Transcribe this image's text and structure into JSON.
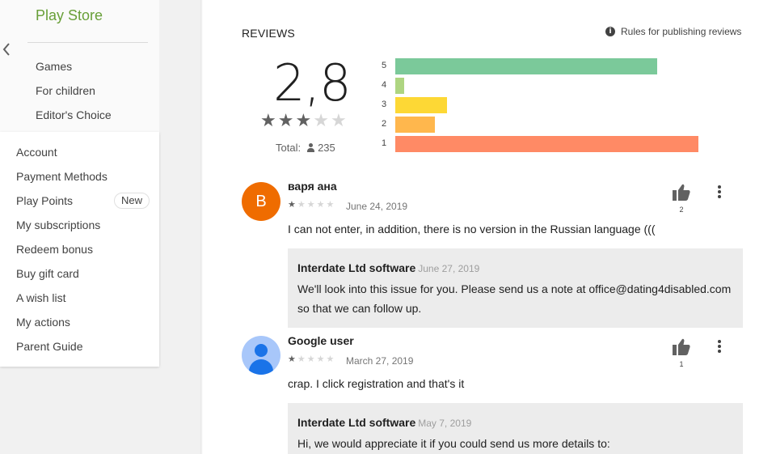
{
  "nav": {
    "store_title": "Play Store",
    "back_icon": "chevron-left-icon",
    "items": [
      {
        "label": "Games"
      },
      {
        "label": "For children"
      },
      {
        "label": "Editor's Choice"
      }
    ]
  },
  "account_menu": {
    "items": [
      {
        "label": "Account"
      },
      {
        "label": "Payment Methods"
      },
      {
        "label": "Play Points",
        "badge": "New"
      },
      {
        "label": "My subscriptions"
      },
      {
        "label": "Redeem bonus"
      },
      {
        "label": "Buy gift card"
      },
      {
        "label": "A wish list"
      },
      {
        "label": "My actions"
      },
      {
        "label": "Parent Guide"
      }
    ]
  },
  "reviews": {
    "title": "REVIEWS",
    "rules_link": "Rules for publishing reviews",
    "rating": "2,8",
    "stars_filled": 3,
    "stars_total": 5,
    "total_label": "Total:",
    "total_count": "235",
    "histogram": [
      {
        "stars": "5",
        "fraction": 0.865,
        "color": "#7bc99a"
      },
      {
        "stars": "4",
        "fraction": 0.03,
        "color": "#aed581"
      },
      {
        "stars": "3",
        "fraction": 0.17,
        "color": "#fdd835"
      },
      {
        "stars": "2",
        "fraction": 0.13,
        "color": "#ffb74d"
      },
      {
        "stars": "1",
        "fraction": 1.0,
        "color": "#ff8a65"
      }
    ],
    "list": [
      {
        "avatar_letter": "B",
        "name": "варя ана",
        "stars": 1,
        "date": "June 24, 2019",
        "text": "I can not enter, in addition, there is no version in the Russian language (((",
        "likes": "2",
        "reply": {
          "author": "Interdate Ltd software",
          "date": "June 27, 2019",
          "text": "We'll look into this issue for you. Please send us a note at office@dating4disabled.com so that we can follow up."
        }
      },
      {
        "avatar_letter": "",
        "name": "Google user",
        "stars": 1,
        "date": "March 27, 2019",
        "text": "crap. I click registration and that's it",
        "likes": "1",
        "reply": {
          "author": "Interdate Ltd software",
          "date": "May 7, 2019",
          "text": "Hi, we would appreciate it if you could send us more details to:"
        }
      }
    ]
  }
}
